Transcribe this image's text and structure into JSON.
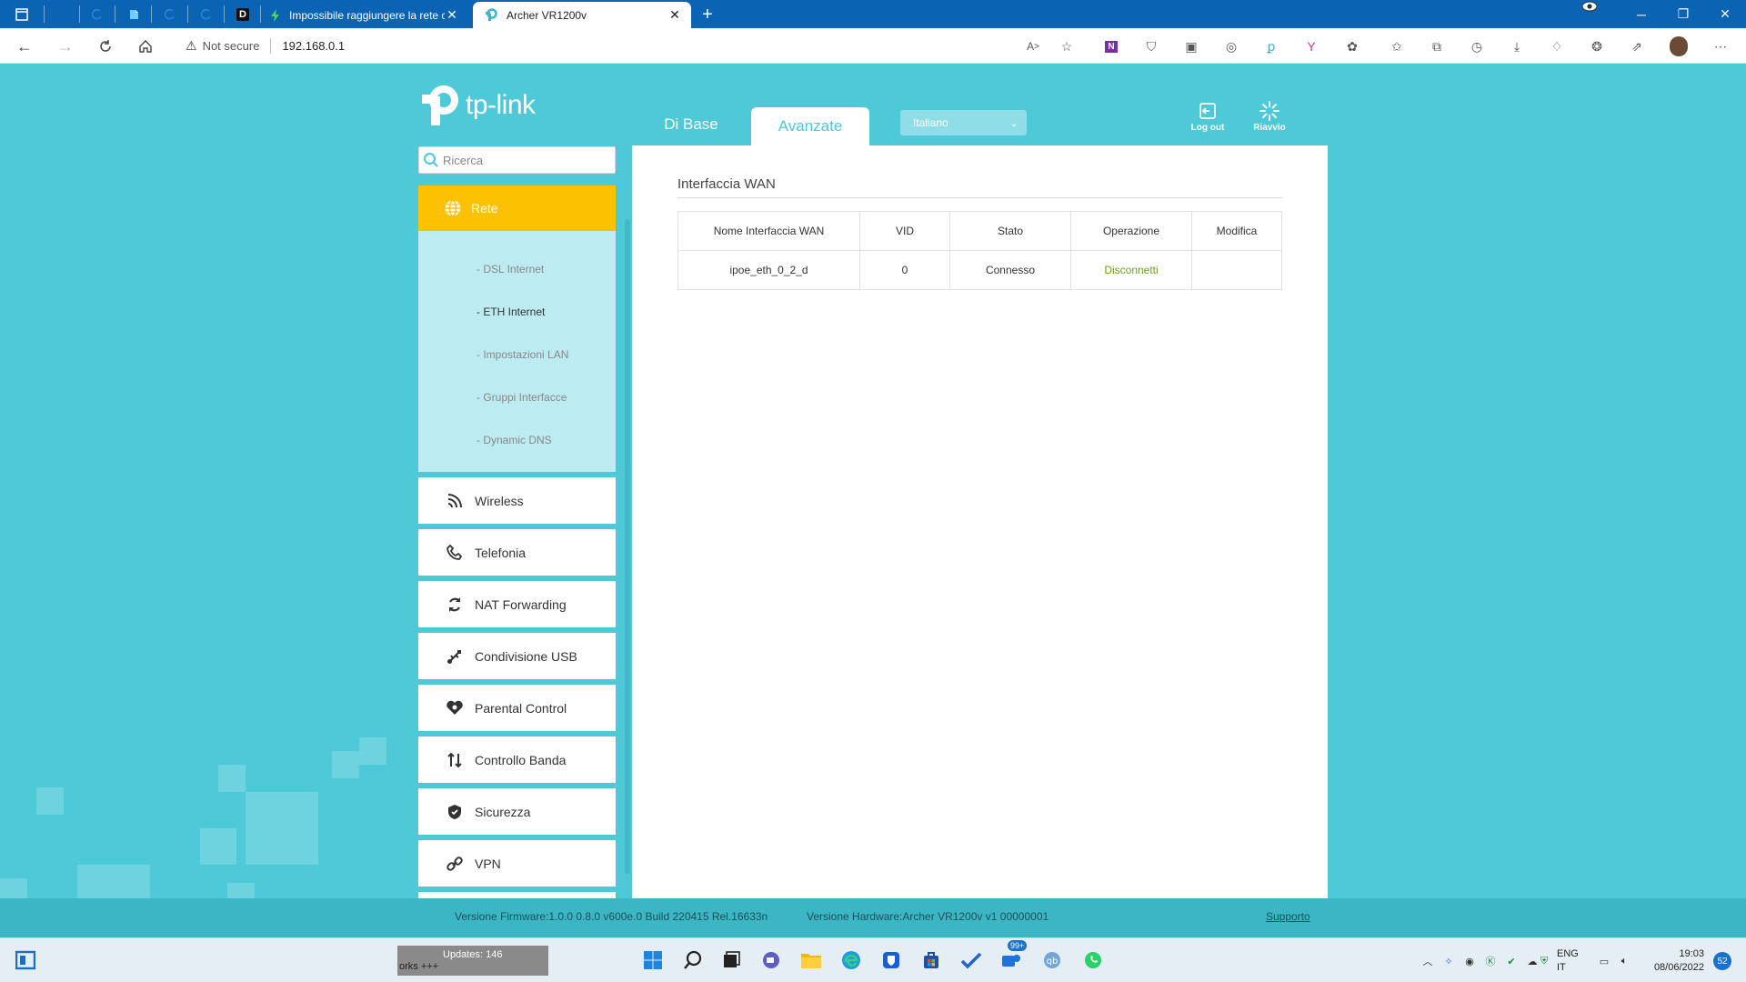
{
  "browser": {
    "tabs": [
      {
        "title": "Impossibile raggiungere la rete c"
      },
      {
        "title": "Archer VR1200v"
      }
    ],
    "pinned_tab_text": "D",
    "address": {
      "security": "Not secure",
      "url": "192.168.0.1"
    }
  },
  "router": {
    "logo": "tp-link",
    "nav_tabs": {
      "basic": "Di Base",
      "advanced": "Avanzate"
    },
    "language": "Italiano",
    "header_buttons": {
      "logout": "Log out",
      "reboot": "Riavvio"
    },
    "search_placeholder": "Ricerca",
    "sidebar": {
      "active_section": "Rete",
      "subitems": [
        "- DSL Internet",
        "- ETH Internet",
        "- Impostazioni LAN",
        "- Gruppi Interfacce",
        "- Dynamic DNS"
      ],
      "menu": [
        "Wireless",
        "Telefonia",
        "NAT Forwarding",
        "Condivisione USB",
        "Parental Control",
        "Controllo Banda",
        "Sicurezza",
        "VPN"
      ]
    },
    "main": {
      "section_title": "Interfaccia WAN",
      "table": {
        "headers": [
          "Nome Interfaccia WAN",
          "VID",
          "Stato",
          "Operazione",
          "Modifica"
        ],
        "rows": [
          [
            "ipoe_eth_0_2_d",
            "0",
            "Connesso",
            "Disconnetti",
            ""
          ]
        ]
      }
    },
    "footer": {
      "firmware": "Versione Firmware:1.0.0 0.8.0 v600e.0 Build 220415 Rel.16633n",
      "hardware": "Versione Hardware:Archer VR1200v v1 00000001",
      "support": "Supporto"
    }
  },
  "taskbar": {
    "widget_line1": "Updates: 146",
    "widget_line2": "orks +++",
    "badge": "99+",
    "lang_top": "ENG",
    "lang_bottom": "IT",
    "time": "19:03",
    "date": "08/06/2022",
    "notifications": "52"
  },
  "colors": {
    "accent": "#4dc9d8",
    "active_section": "#fcc100",
    "operation_link": "#6e9e1e"
  }
}
